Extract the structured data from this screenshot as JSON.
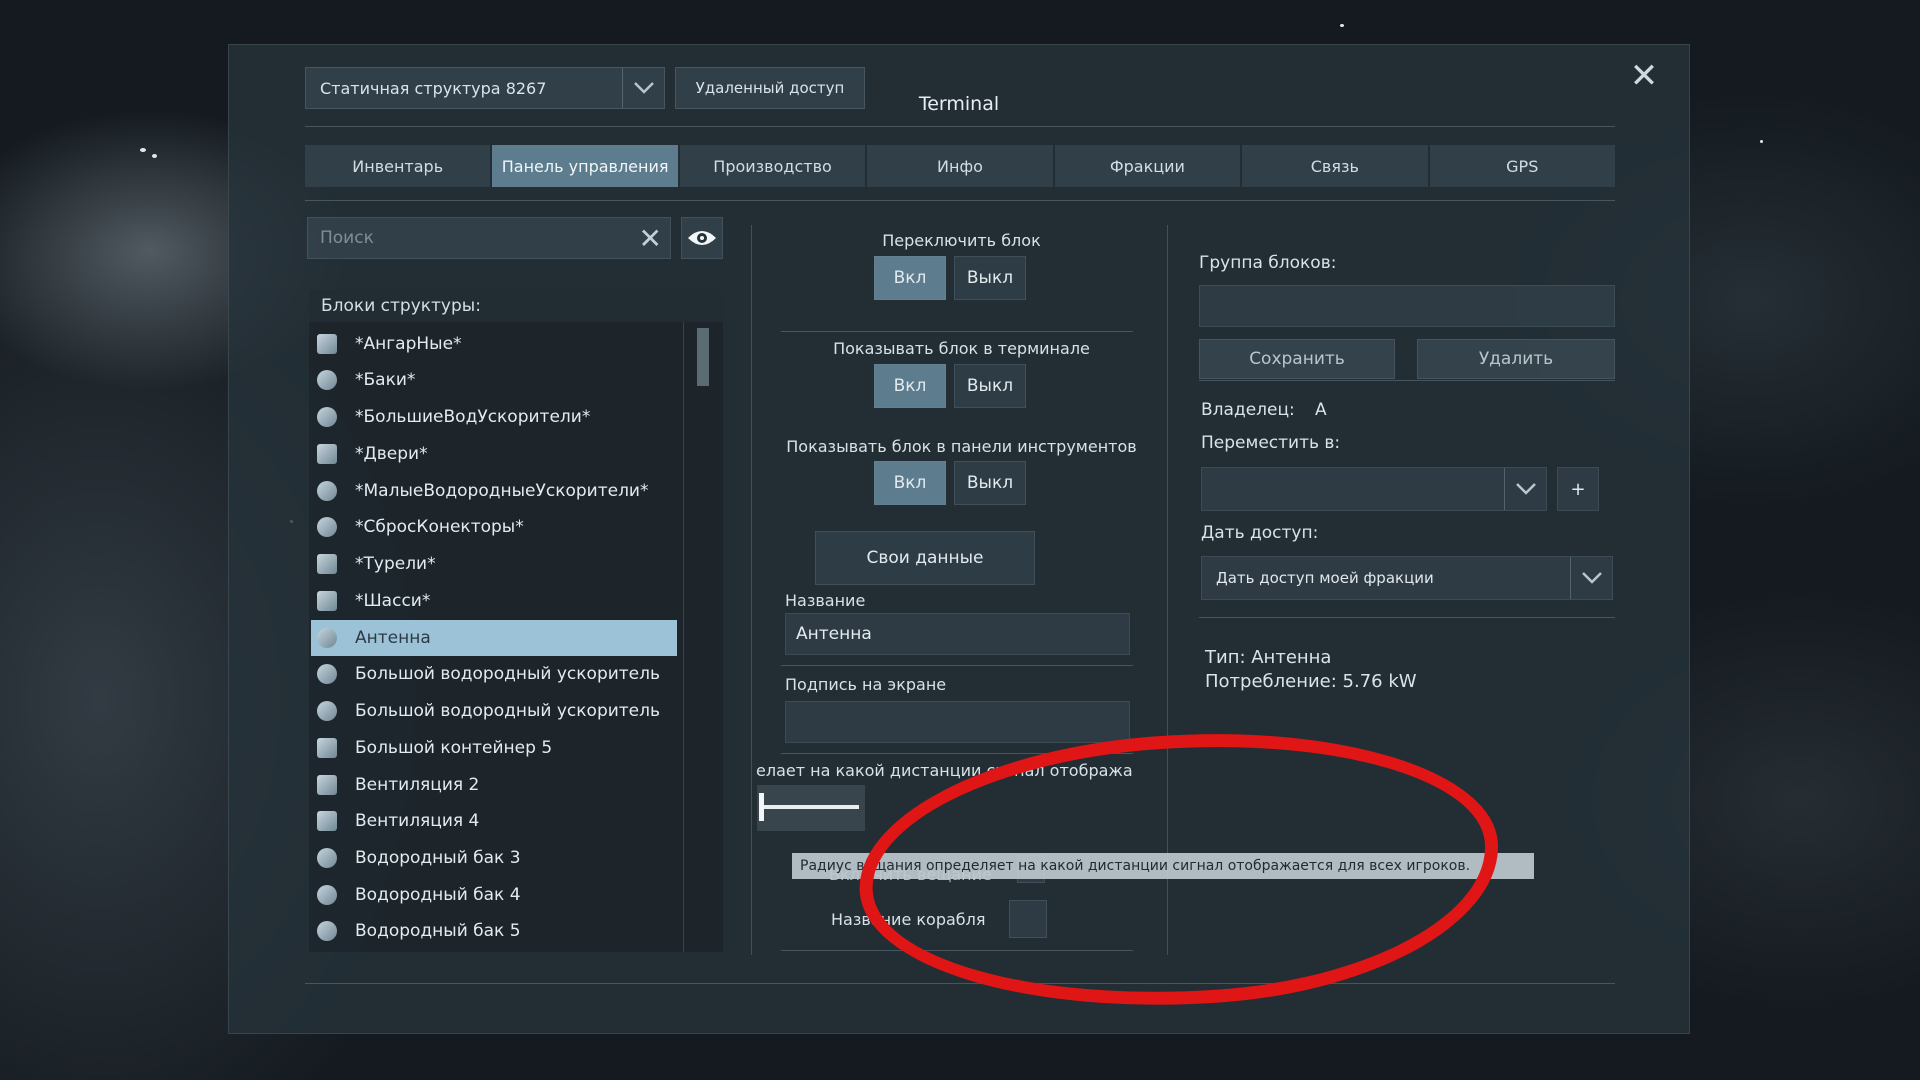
{
  "window": {
    "title": "Terminal",
    "structure_select": "Статичная структура 8267",
    "remote_access_label": "Удаленный доступ"
  },
  "tabs": [
    {
      "label": "Инвентарь",
      "active": false
    },
    {
      "label": "Панель управления",
      "active": true
    },
    {
      "label": "Производство",
      "active": false
    },
    {
      "label": "Инфо",
      "active": false
    },
    {
      "label": "Фракции",
      "active": false
    },
    {
      "label": "Связь",
      "active": false
    },
    {
      "label": "GPS",
      "active": false
    }
  ],
  "left": {
    "search_placeholder": "Поиск",
    "blocks_header": "Блоки структуры:",
    "blocks": [
      "*АнгарНые*",
      "*Баки*",
      "*БольшиеВодУскорители*",
      "*Двери*",
      "*МалыеВодородныеУскорители*",
      "*СбросКонекторы*",
      "*Турели*",
      "*Шасси*",
      "Антенна",
      "Большой водородный ускоритель",
      "Большой водородный ускоритель",
      "Большой контейнер 5",
      "Вентиляция 2",
      "Вентиляция 4",
      "Водородный бак 3",
      "Водородный бак 4",
      "Водородный бак 5"
    ],
    "selected_index": 8
  },
  "middle": {
    "toggle_block_label": "Переключить блок",
    "show_in_terminal_label": "Показывать блок в терминале",
    "show_in_toolbar_label": "Показывать блок в панели инструментов",
    "on_label": "Вкл",
    "off_label": "Выкл",
    "custom_data_label": "Свои данные",
    "name_label": "Название",
    "name_value": "Антенна",
    "hud_caption_label": "Подпись на экране",
    "radius_label": "елает на какой дистанции сигнал отобража",
    "tooltip": "Радиус вещания определяет на какой дистанции сигнал отображается для всех игроков.",
    "hidden_row_label": "Включить вещание",
    "ship_name_label": "Название корабля"
  },
  "right": {
    "block_group_label": "Группа блоков:",
    "save_label": "Сохранить",
    "delete_label": "Удалить",
    "owner_label": "Владелец:",
    "owner_value": "A",
    "move_to_label": "Переместить в:",
    "plus_label": "+",
    "give_access_label": "Дать доступ:",
    "give_access_value": "Дать доступ моей фракции",
    "type_line": "Тип: Антенна",
    "power_line": "Потребление: 5.76 kW"
  },
  "colors": {
    "accent": "#5d7c8e",
    "selected_item": "#9cc2d8",
    "annotation": "#e01515"
  }
}
